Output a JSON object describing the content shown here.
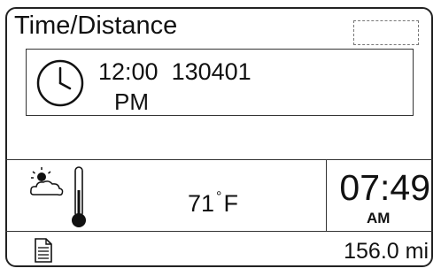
{
  "screen": {
    "title": "Time/Distance"
  },
  "time_panel": {
    "time": "12:00",
    "code": "130401",
    "period": "PM"
  },
  "status": {
    "temperature_value": "71",
    "temperature_unit": "F",
    "clock_time": "07:49",
    "clock_period": "AM",
    "distance": "156.0 mi"
  },
  "icons": [
    "clock-icon",
    "weather-sun-cloud-icon",
    "thermometer-icon",
    "document-icon"
  ]
}
